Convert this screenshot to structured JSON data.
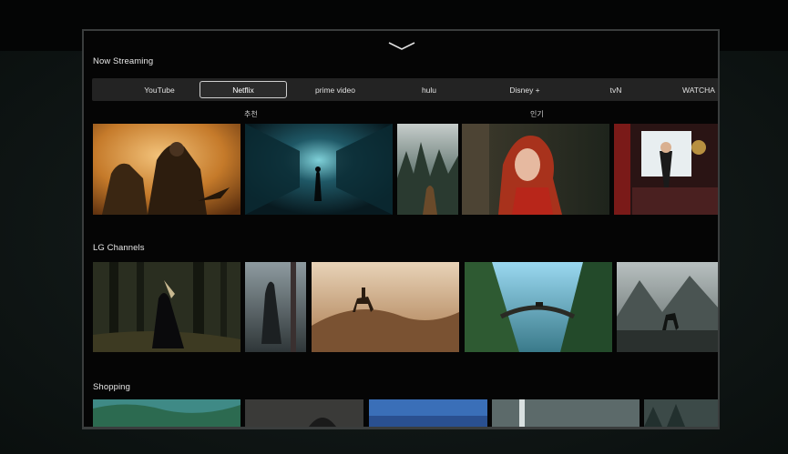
{
  "rows": {
    "streaming_title": "Now Streaming",
    "channels_title": "LG Channels",
    "shopping_title": "Shopping"
  },
  "tabs": [
    {
      "label": "YouTube",
      "selected": false
    },
    {
      "label": "Netflix",
      "selected": true
    },
    {
      "label": "prime video",
      "selected": false
    },
    {
      "label": "hulu",
      "selected": false
    },
    {
      "label": "Disney +",
      "selected": false
    },
    {
      "label": "tvN",
      "selected": false
    },
    {
      "label": "WATCHA",
      "selected": false
    }
  ],
  "subheads": {
    "recommended": "추천",
    "popular": "인기"
  },
  "icons": {
    "collapse": "chevron-down-icon"
  },
  "colors": {
    "accent_border": "#cfcfcf",
    "tab_bar": "#232323"
  }
}
